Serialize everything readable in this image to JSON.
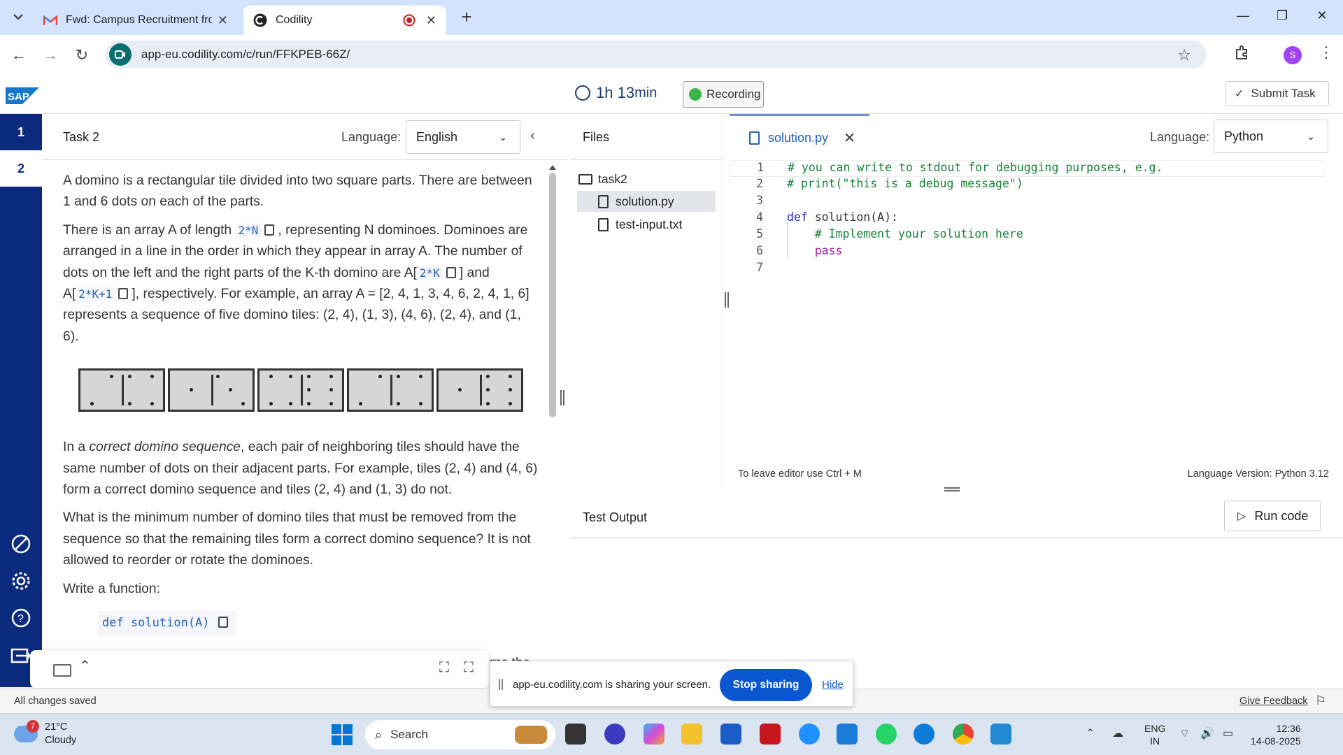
{
  "browser": {
    "tabs": [
      {
        "title": "Fwd: Campus Recruitment from",
        "favicon": "gmail-icon"
      },
      {
        "title": "Codility",
        "favicon": "codility-icon",
        "active": true
      }
    ],
    "url": "app-eu.codility.com/c/run/FFKPEB-66Z/",
    "profile_initial": "S"
  },
  "header": {
    "timer_hours": "1h",
    "timer_minutes": "13",
    "timer_unit": "min",
    "recording_label": "Recording",
    "submit_label": "Submit Task"
  },
  "rail": {
    "items": [
      "1",
      "2"
    ]
  },
  "task": {
    "title": "Task 2",
    "language_label": "Language:",
    "language_value": "English",
    "p1": "A domino is a rectangular tile divided into two square parts. There are between 1 and 6 dots on each of the parts.",
    "p2_a": "There is an array A of length ",
    "code_2n": "2*N",
    "p2_b": ", representing N dominoes. Dominoes are arranged in a line in the order in which they appear in array A. The number of dots on the left and the right parts of the K-th domino are A[",
    "code_2k": "2*K",
    "p2_c": "] and A[",
    "code_2k1": "2*K+1",
    "p2_d": "], respectively. For example, an array A = [2, 4, 1, 3, 4, 6, 2, 4, 1, 6] represents a sequence of five domino tiles: (2, 4), (1, 3), (4, 6), (2, 4), and (1, 6).",
    "p3_a": "In a ",
    "p3_em": "correct domino sequence",
    "p3_b": ", each pair of neighboring tiles should have the same number of dots on their adjacent parts. For example, tiles (2, 4) and (4, 6) form a correct domino sequence and tiles (2, 4) and (1, 3) do not.",
    "p4": "What is the minimum number of domino tiles that must be removed from the sequence so that the remaining tiles form a correct domino sequence? It is not allowed to reorder or rotate the dominoes.",
    "p5": "Write a function:",
    "def_sig": "def solution(A)",
    "hidden_tail": "rns the"
  },
  "files": {
    "title": "Files",
    "folder": "task2",
    "items": [
      "solution.py",
      "test-input.txt"
    ]
  },
  "editor": {
    "tab_name": "solution.py",
    "language_label": "Language:",
    "language_value": "Python",
    "lines": [
      {
        "n": "1",
        "text": "# you can write to stdout for debugging purposes, e.g."
      },
      {
        "n": "2",
        "text": "# print(\"this is a debug message\")"
      },
      {
        "n": "3",
        "text": ""
      },
      {
        "n": "4",
        "kw": "def",
        "text": " solution(A):"
      },
      {
        "n": "5",
        "text": "    # Implement your solution here"
      },
      {
        "n": "6",
        "kw2": "pass"
      },
      {
        "n": "7",
        "text": ""
      }
    ],
    "footer_left": "To leave editor use Ctrl + M",
    "footer_right": "Language Version: Python 3.12"
  },
  "test_output": {
    "title": "Test Output",
    "run_label": "Run code"
  },
  "status": {
    "saved": "All changes saved",
    "feedback": "Give Feedback"
  },
  "share_bar": {
    "text": "app-eu.codility.com is sharing your screen.",
    "stop": "Stop sharing",
    "hide": "Hide"
  },
  "taskbar": {
    "weather_temp": "21°C",
    "weather_desc": "Cloudy",
    "weather_badge": "7",
    "search": "Search",
    "lang_top": "ENG",
    "lang_bottom": "IN",
    "time": "12:36",
    "date": "14-08-2025"
  },
  "colors": {
    "rail": "#0d2b7e",
    "accent_blue": "#2962b6",
    "recording_green": "#3bb54a",
    "stop_button": "#0b57d0"
  }
}
